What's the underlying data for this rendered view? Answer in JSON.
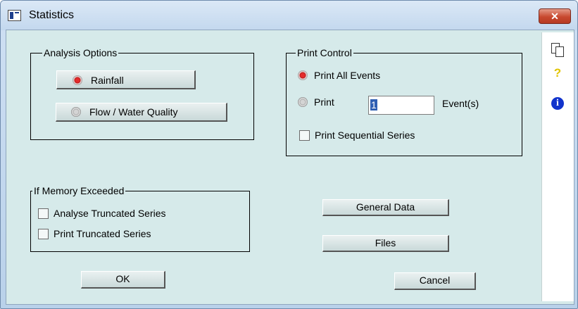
{
  "window": {
    "title": "Statistics",
    "close_glyph": "✕"
  },
  "analysis_options": {
    "label": "Analysis Options",
    "rainfall_label": "Rainfall",
    "flow_label": "Flow / Water Quality",
    "selected": "Rainfall"
  },
  "print_control": {
    "label": "Print Control",
    "print_all_label": "Print All Events",
    "print_label": "Print",
    "events_value": "1",
    "events_suffix": "Event(s)",
    "sequential_label": "Print Sequential Series",
    "sequential_checked": false,
    "selected": "Print All Events"
  },
  "memory": {
    "label": "If Memory Exceeded",
    "analyse_label": "Analyse Truncated Series",
    "analyse_checked": false,
    "print_label": "Print Truncated Series",
    "print_checked": false
  },
  "buttons": {
    "general_data": "General Data",
    "files": "Files",
    "ok": "OK",
    "cancel": "Cancel"
  },
  "side_toolbar": {
    "icons": [
      "copy-icon",
      "help-icon",
      "info-icon"
    ],
    "help_glyph": "?",
    "info_glyph": "i"
  }
}
